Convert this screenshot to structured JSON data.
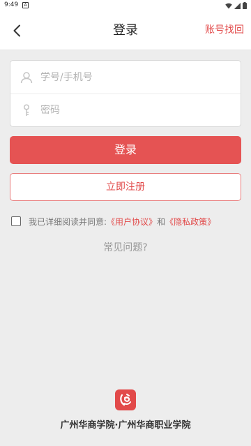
{
  "status_bar": {
    "time": "9:49",
    "notification_glyph": "A",
    "icons": [
      "wifi-icon",
      "signal-icon",
      "battery-icon"
    ]
  },
  "header": {
    "back_icon": "chevron-left-icon",
    "title": "登录",
    "action_label": "账号找回"
  },
  "form": {
    "username": {
      "icon": "user-icon",
      "placeholder": "学号/手机号",
      "value": ""
    },
    "password": {
      "icon": "key-icon",
      "placeholder": "密码",
      "value": ""
    }
  },
  "buttons": {
    "login_label": "登录",
    "register_label": "立即注册"
  },
  "agreement": {
    "checked": false,
    "prefix": "我已详细阅读并同意:",
    "user_agreement": "《用户协议》",
    "conjunction": "和",
    "privacy_policy": "《隐私政策》"
  },
  "faq_label": "常见问题?",
  "footer": {
    "logo_icon": "school-logo-icon",
    "school_name": "广州华商学院·广州华商职业学院"
  },
  "colors": {
    "accent": "#e24a4a",
    "primary_button": "#e55353",
    "background": "#ededed"
  }
}
